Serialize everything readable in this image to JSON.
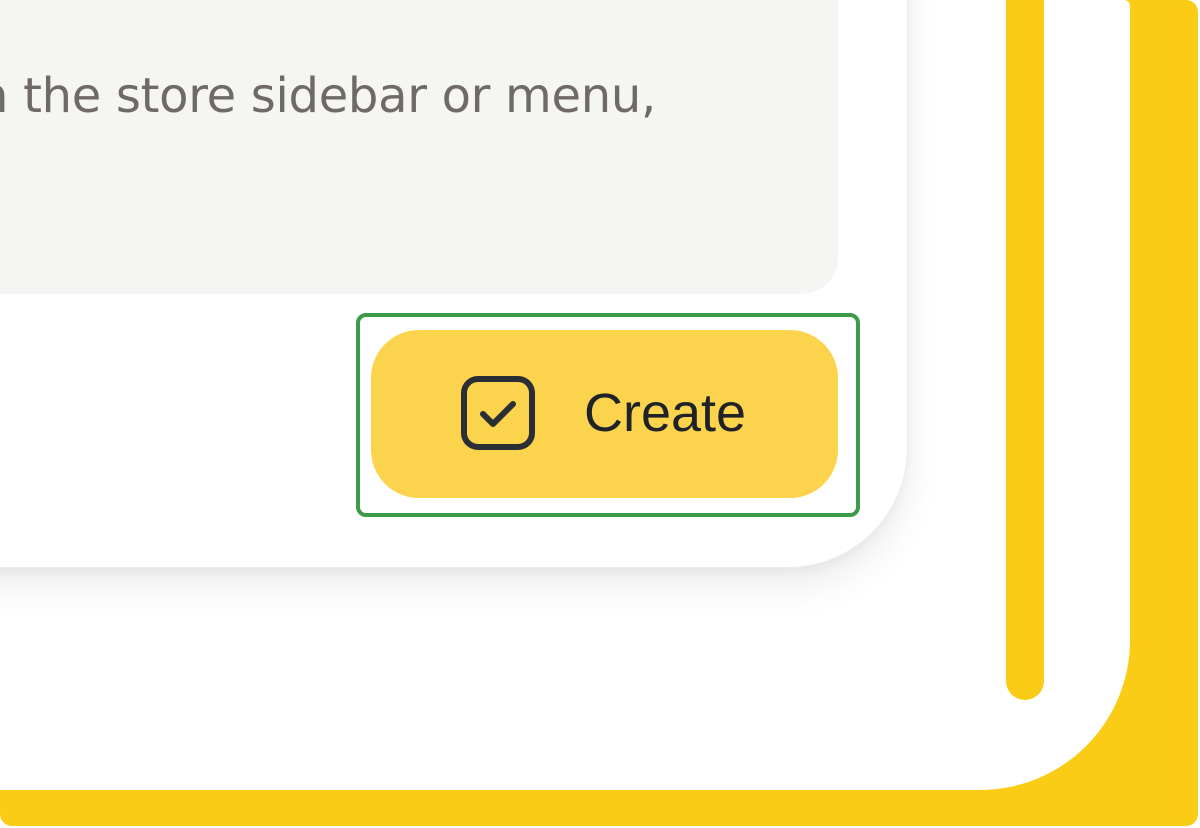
{
  "dialog": {
    "message_fragment": "n the store sidebar or menu,"
  },
  "actions": {
    "create_label": "Create",
    "create_icon": "checkbox-check-icon"
  },
  "colors": {
    "accent_yellow": "#FACC15",
    "button_yellow": "#FCD34D",
    "highlight_green": "#3E9B4A",
    "message_background": "#F5F5F3",
    "message_text": "#6f6a66",
    "button_text": "#1f2328"
  }
}
